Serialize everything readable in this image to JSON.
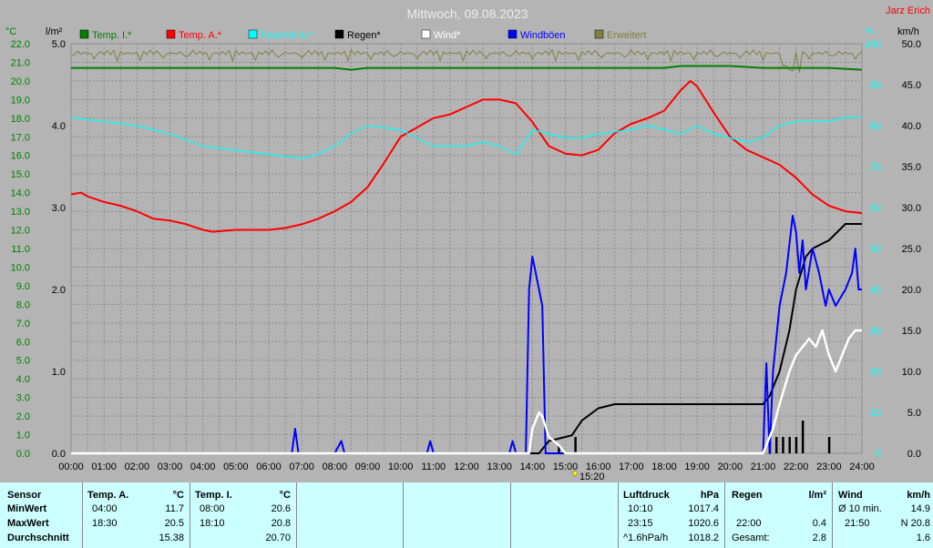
{
  "header": {
    "title": "Mittwoch, 09.08.2023",
    "station": "Jarz Erich"
  },
  "axis_units": {
    "temp": "°C",
    "rain": "l/m²",
    "humidity": "%",
    "wind": "km/h"
  },
  "colors": {
    "background": "#b4b4b4",
    "grid": "#8c8c8c",
    "temp_inside": "#008000",
    "temp_outside": "#ff0000",
    "humidity": "#00ffff",
    "rain": "#000000",
    "wind": "#ffffff",
    "gusts": "#0000ff",
    "extra": "#808040",
    "stats_bg": "#ccffff"
  },
  "legend": [
    {
      "label": "Temp. I.*",
      "color": "#008000"
    },
    {
      "label": "Temp. A.*",
      "color": "#ff0000"
    },
    {
      "label": "Feuchte A.*",
      "color": "#00ffff"
    },
    {
      "label": "Regen*",
      "color": "#000000"
    },
    {
      "label": "Wind*",
      "color": "#ffffff"
    },
    {
      "label": "Windböen",
      "color": "#0000ff"
    },
    {
      "label": "Erweitert",
      "color": "#808040"
    }
  ],
  "marker_label": "15:20",
  "chart_data": {
    "type": "line",
    "title": "Mittwoch, 09.08.2023",
    "x_ticks": [
      "00:00",
      "01:00",
      "02:00",
      "03:00",
      "04:00",
      "05:00",
      "06:00",
      "07:00",
      "08:00",
      "09:00",
      "10:00",
      "11:00",
      "12:00",
      "13:00",
      "14:00",
      "15:00",
      "16:00",
      "17:00",
      "18:00",
      "19:00",
      "20:00",
      "21:00",
      "22:00",
      "23:00",
      "24:00"
    ],
    "temp_ticks": [
      "0.0",
      "1.0",
      "2.0",
      "3.0",
      "4.0",
      "5.0",
      "6.0",
      "7.0",
      "8.0",
      "9.0",
      "10.0",
      "11.0",
      "12.0",
      "13.0",
      "14.0",
      "15.0",
      "16.0",
      "17.0",
      "18.0",
      "19.0",
      "20.0",
      "21.0",
      "22.0"
    ],
    "rain_ticks": [
      "0.0",
      "1.0",
      "2.0",
      "3.0",
      "4.0",
      "5.0"
    ],
    "humidity_ticks": [
      "0",
      "10",
      "20",
      "30",
      "40",
      "50",
      "60",
      "70",
      "80",
      "90",
      "100"
    ],
    "wind_ticks": [
      "0.0",
      "5.0",
      "10.0",
      "15.0",
      "20.0",
      "25.0",
      "30.0",
      "35.0",
      "40.0",
      "45.0",
      "50.0"
    ],
    "ranges": {
      "temp": [
        0,
        22
      ],
      "rain": [
        0,
        5
      ],
      "humidity": [
        0,
        100
      ],
      "wind": [
        0,
        50
      ],
      "hours": [
        0,
        24
      ]
    },
    "grid": true,
    "series": [
      {
        "name": "Temp. A.*",
        "axis": "temp",
        "points": [
          [
            0,
            13.9
          ],
          [
            0.3,
            14.0
          ],
          [
            0.5,
            13.8
          ],
          [
            1,
            13.5
          ],
          [
            1.5,
            13.3
          ],
          [
            2,
            13.0
          ],
          [
            2.5,
            12.6
          ],
          [
            3,
            12.5
          ],
          [
            3.5,
            12.3
          ],
          [
            4,
            12.0
          ],
          [
            4.3,
            11.9
          ],
          [
            5,
            12.0
          ],
          [
            5.5,
            12.0
          ],
          [
            6,
            12.0
          ],
          [
            6.5,
            12.1
          ],
          [
            7,
            12.3
          ],
          [
            7.5,
            12.6
          ],
          [
            8,
            13.0
          ],
          [
            8.5,
            13.5
          ],
          [
            9,
            14.3
          ],
          [
            9.5,
            15.6
          ],
          [
            10,
            17.0
          ],
          [
            10.5,
            17.5
          ],
          [
            11,
            18.0
          ],
          [
            11.5,
            18.2
          ],
          [
            12,
            18.6
          ],
          [
            12.5,
            19.0
          ],
          [
            13,
            19.0
          ],
          [
            13.5,
            18.8
          ],
          [
            14,
            17.8
          ],
          [
            14.5,
            16.5
          ],
          [
            15,
            16.1
          ],
          [
            15.5,
            16.0
          ],
          [
            16,
            16.3
          ],
          [
            16.5,
            17.2
          ],
          [
            17,
            17.7
          ],
          [
            17.5,
            18.0
          ],
          [
            18,
            18.4
          ],
          [
            18.5,
            19.5
          ],
          [
            18.8,
            20.0
          ],
          [
            19,
            19.7
          ],
          [
            19.5,
            18.3
          ],
          [
            20,
            17.0
          ],
          [
            20.5,
            16.3
          ],
          [
            21,
            15.9
          ],
          [
            21.5,
            15.5
          ],
          [
            22,
            14.8
          ],
          [
            22.5,
            13.9
          ],
          [
            23,
            13.3
          ],
          [
            23.5,
            13.0
          ],
          [
            24,
            12.9
          ]
        ]
      },
      {
        "name": "Feuchte A.*",
        "axis": "humidity",
        "points": [
          [
            0,
            82
          ],
          [
            1,
            81
          ],
          [
            2,
            80
          ],
          [
            3,
            78
          ],
          [
            4,
            75
          ],
          [
            5,
            74
          ],
          [
            6,
            73
          ],
          [
            7,
            72
          ],
          [
            7.5,
            73
          ],
          [
            8,
            75
          ],
          [
            8.5,
            78
          ],
          [
            9,
            80
          ],
          [
            10,
            79
          ],
          [
            10.5,
            77
          ],
          [
            11,
            75
          ],
          [
            12,
            75
          ],
          [
            12.5,
            76
          ],
          [
            13,
            75
          ],
          [
            13.5,
            73
          ],
          [
            14,
            79
          ],
          [
            14.5,
            78
          ],
          [
            15,
            77
          ],
          [
            15.5,
            77
          ],
          [
            16,
            78
          ],
          [
            17,
            79
          ],
          [
            17.5,
            80
          ],
          [
            18,
            79
          ],
          [
            18.5,
            78
          ],
          [
            19,
            80
          ],
          [
            19.5,
            78
          ],
          [
            20,
            77
          ],
          [
            20.5,
            76
          ],
          [
            21,
            77
          ],
          [
            21.5,
            80
          ],
          [
            22,
            81
          ],
          [
            22.5,
            81
          ],
          [
            23,
            81
          ],
          [
            23.5,
            82
          ],
          [
            24,
            82
          ]
        ]
      },
      {
        "name": "Temp. I.*",
        "axis": "temp",
        "points": [
          [
            0,
            20.7
          ],
          [
            8,
            20.7
          ],
          [
            8.5,
            20.6
          ],
          [
            9,
            20.7
          ],
          [
            18,
            20.7
          ],
          [
            18.5,
            20.8
          ],
          [
            20,
            20.8
          ],
          [
            21,
            20.7
          ],
          [
            23,
            20.7
          ],
          [
            24,
            20.6
          ]
        ]
      },
      {
        "name": "Regen*",
        "axis": "rain",
        "points": [
          [
            0,
            0
          ],
          [
            14.2,
            0
          ],
          [
            14.5,
            0.15
          ],
          [
            15,
            0.2
          ],
          [
            15.2,
            0.22
          ],
          [
            15.5,
            0.4
          ],
          [
            16,
            0.55
          ],
          [
            16.5,
            0.6
          ],
          [
            17,
            0.6
          ],
          [
            18,
            0.6
          ],
          [
            19,
            0.6
          ],
          [
            20,
            0.6
          ],
          [
            21,
            0.6
          ],
          [
            21.2,
            0.7
          ],
          [
            21.5,
            1.0
          ],
          [
            21.8,
            1.5
          ],
          [
            22,
            2.0
          ],
          [
            22.3,
            2.4
          ],
          [
            22.5,
            2.5
          ],
          [
            23,
            2.6
          ],
          [
            23.5,
            2.8
          ],
          [
            24,
            2.8
          ]
        ]
      },
      {
        "name": "Windböen",
        "axis": "wind",
        "points": [
          [
            0,
            0
          ],
          [
            6.7,
            0
          ],
          [
            6.8,
            3
          ],
          [
            6.9,
            0
          ],
          [
            8,
            0
          ],
          [
            8.2,
            1.5
          ],
          [
            8.3,
            0
          ],
          [
            10.8,
            0
          ],
          [
            10.9,
            1.5
          ],
          [
            11,
            0
          ],
          [
            13.3,
            0
          ],
          [
            13.4,
            1.5
          ],
          [
            13.5,
            0
          ],
          [
            13.8,
            0
          ],
          [
            13.9,
            20
          ],
          [
            14,
            24
          ],
          [
            14.1,
            22
          ],
          [
            14.2,
            20
          ],
          [
            14.3,
            18
          ],
          [
            14.4,
            0
          ],
          [
            21,
            0
          ],
          [
            21.1,
            11
          ],
          [
            21.2,
            0
          ],
          [
            21.3,
            10
          ],
          [
            21.5,
            18
          ],
          [
            21.7,
            22
          ],
          [
            21.9,
            29
          ],
          [
            22,
            27
          ],
          [
            22.1,
            22
          ],
          [
            22.2,
            26
          ],
          [
            22.3,
            20
          ],
          [
            22.5,
            25
          ],
          [
            22.7,
            22
          ],
          [
            22.9,
            18
          ],
          [
            23,
            20
          ],
          [
            23.2,
            18
          ],
          [
            23.5,
            20
          ],
          [
            23.7,
            22
          ],
          [
            23.8,
            25
          ],
          [
            23.9,
            20
          ],
          [
            24,
            20
          ]
        ]
      },
      {
        "name": "Wind*",
        "axis": "wind",
        "points": [
          [
            0,
            0
          ],
          [
            13.9,
            0
          ],
          [
            14,
            3
          ],
          [
            14.1,
            4
          ],
          [
            14.2,
            5
          ],
          [
            14.3,
            4.5
          ],
          [
            14.5,
            2
          ],
          [
            14.8,
            1
          ],
          [
            15,
            0
          ],
          [
            21,
            0
          ],
          [
            21.3,
            3
          ],
          [
            21.5,
            6
          ],
          [
            21.8,
            10
          ],
          [
            22,
            12
          ],
          [
            22.2,
            13
          ],
          [
            22.4,
            14
          ],
          [
            22.6,
            13
          ],
          [
            22.8,
            15
          ],
          [
            23,
            12
          ],
          [
            23.2,
            10
          ],
          [
            23.4,
            12
          ],
          [
            23.6,
            14
          ],
          [
            23.8,
            15
          ],
          [
            24,
            15
          ]
        ]
      }
    ],
    "rain_bars": [
      [
        14.8,
        0.1
      ],
      [
        15.3,
        0.2
      ],
      [
        21.2,
        0.2
      ],
      [
        21.4,
        0.2
      ],
      [
        21.6,
        0.2
      ],
      [
        21.8,
        0.2
      ],
      [
        22,
        0.2
      ],
      [
        22.2,
        0.4
      ],
      [
        23,
        0.2
      ]
    ]
  },
  "stats": {
    "row_labels": {
      "sensor": "Sensor",
      "min": "MinWert",
      "max": "MaxWert",
      "avg": "Durchschnitt"
    },
    "temp_out": {
      "head": "Temp. A.",
      "unit": "°C",
      "min_time": "04:00",
      "min_val": "11.7",
      "max_time": "18:30",
      "max_val": "20.5",
      "avg": "15.38"
    },
    "temp_in": {
      "head": "Temp. I.",
      "unit": "°C",
      "min_time": "08:00",
      "min_val": "20.6",
      "max_time": "18:10",
      "max_val": "20.8",
      "avg": "20.70"
    },
    "pressure": {
      "head": "Luftdruck",
      "unit": "hPa",
      "min_time": "10:10",
      "min_val": "1017.4",
      "max_time": "23:15",
      "max_val": "1020.6",
      "trend": "^1.6hPa/h",
      "avg": "1018.2"
    },
    "rain": {
      "head": "Regen",
      "unit": "l/m²",
      "max_time": "22:00",
      "max_val": "0.4",
      "total_label": "Gesamt:",
      "total": "2.8"
    },
    "wind": {
      "head": "Wind",
      "unit": "km/h",
      "avg_label": "Ø 10 min.",
      "avg_val": "14.9",
      "max_time": "21:50",
      "max_val": "N 20.8",
      "avg": "1.6"
    }
  }
}
